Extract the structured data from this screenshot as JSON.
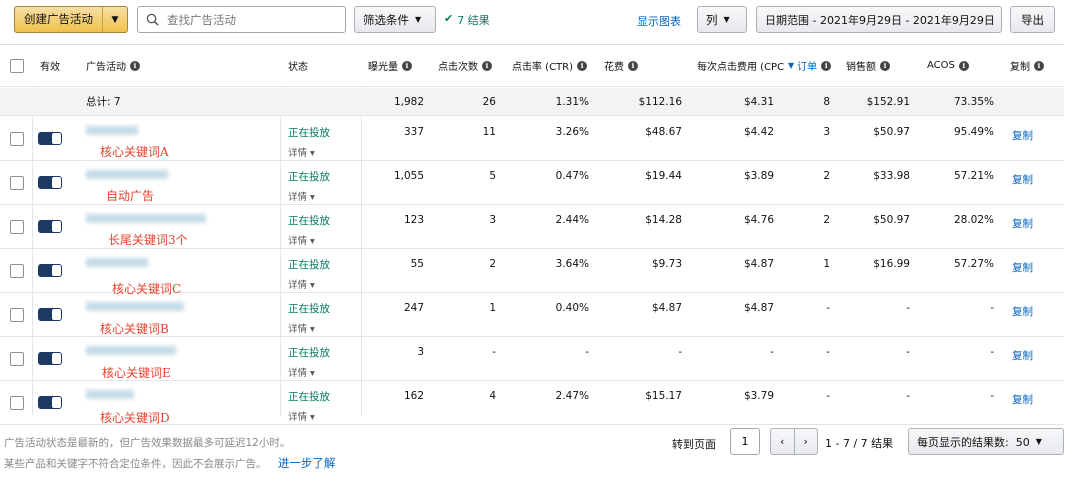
{
  "toolbar": {
    "create_label": "创建广告活动",
    "search_placeholder": "查找广告活动",
    "filter_label": "筛选条件",
    "results_text": "7 结果",
    "show_chart": "显示图表",
    "columns_label": "列",
    "date_range": "日期范围 - 2021年9月29日 - 2021年9月29日",
    "export_label": "导出"
  },
  "table": {
    "headers": {
      "active": "有效",
      "campaign": "广告活动",
      "status": "状态",
      "impressions": "曝光量",
      "clicks": "点击次数",
      "ctr": "点击率 (CTR)",
      "spend": "花费",
      "cpc": "每次点击费用 (CPC)",
      "orders": "订单",
      "sales": "销售额",
      "acos": "ACOS",
      "copy": "复制"
    },
    "totals": {
      "label": "总计: 7",
      "impressions": "1,982",
      "clicks": "26",
      "ctr": "1.31%",
      "spend": "$112.16",
      "cpc": "$4.31",
      "orders": "8",
      "sales": "$152.91",
      "acos": "73.35%"
    },
    "rows": [
      {
        "annotation": "核心关键词A",
        "status": "正在投放",
        "details": "详情",
        "impressions": "337",
        "clicks": "11",
        "ctr": "3.26%",
        "spend": "$48.67",
        "cpc": "$4.42",
        "orders": "3",
        "sales": "$50.97",
        "acos": "95.49%",
        "copy": "复制"
      },
      {
        "annotation": "自动广告",
        "status": "正在投放",
        "details": "详情",
        "impressions": "1,055",
        "clicks": "5",
        "ctr": "0.47%",
        "spend": "$19.44",
        "cpc": "$3.89",
        "orders": "2",
        "sales": "$33.98",
        "acos": "57.21%",
        "copy": "复制"
      },
      {
        "annotation": "长尾关键词3个",
        "status": "正在投放",
        "details": "详情",
        "impressions": "123",
        "clicks": "3",
        "ctr": "2.44%",
        "spend": "$14.28",
        "cpc": "$4.76",
        "orders": "2",
        "sales": "$50.97",
        "acos": "28.02%",
        "copy": "复制"
      },
      {
        "annotation": "核心关键词C",
        "status": "正在投放",
        "details": "详情",
        "impressions": "55",
        "clicks": "2",
        "ctr": "3.64%",
        "spend": "$9.73",
        "cpc": "$4.87",
        "orders": "1",
        "sales": "$16.99",
        "acos": "57.27%",
        "copy": "复制"
      },
      {
        "annotation": "核心关键词B",
        "status": "正在投放",
        "details": "详情",
        "impressions": "247",
        "clicks": "1",
        "ctr": "0.40%",
        "spend": "$4.87",
        "cpc": "$4.87",
        "orders": "-",
        "sales": "-",
        "acos": "-",
        "copy": "复制"
      },
      {
        "annotation": "核心关键词E",
        "status": "正在投放",
        "details": "详情",
        "impressions": "3",
        "clicks": "-",
        "ctr": "-",
        "spend": "-",
        "cpc": "-",
        "orders": "-",
        "sales": "-",
        "acos": "-",
        "copy": "复制"
      },
      {
        "annotation": "核心关键词D",
        "status": "正在投放",
        "details": "详情",
        "impressions": "162",
        "clicks": "4",
        "ctr": "2.47%",
        "spend": "$15.17",
        "cpc": "$3.79",
        "orders": "-",
        "sales": "-",
        "acos": "-",
        "copy": "复制"
      }
    ]
  },
  "footer": {
    "note1": "广告活动状态是最新的，但广告效果数据最多可延迟12小时。",
    "note2": "某些产品和关键字不符合定位条件，因此不会展示广告。",
    "learn_more": "进一步了解",
    "goto_label": "转到页面",
    "page_value": "1",
    "range_text": "1 - 7 / 7 结果",
    "per_page": "每页显示的结果数:  50"
  },
  "colors": {
    "primary_button": "#f0c14b",
    "success_green": "#067d62",
    "link_blue": "#0066c0",
    "annotation_red": "#e8432e",
    "toggle_navy": "#1c3a63"
  }
}
